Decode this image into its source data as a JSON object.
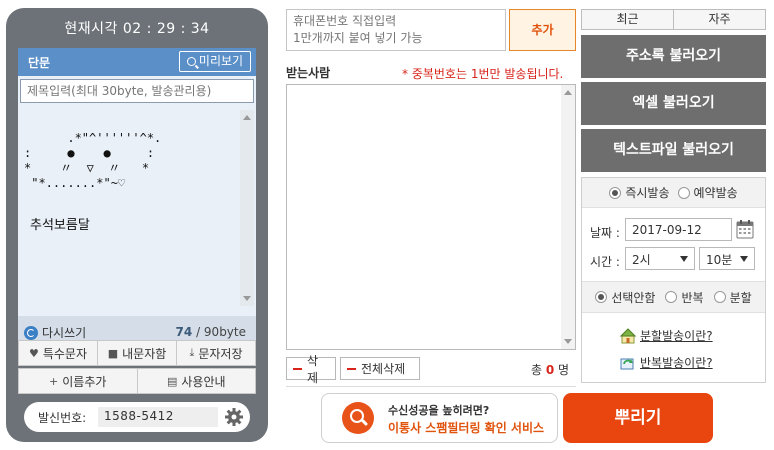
{
  "phone": {
    "clock": "현재시각 02 : 29 : 34",
    "msg_type": "단문",
    "preview_label": "미리보기",
    "title_placeholder": "제목입력(최대 30byte, 발송관리용)",
    "message_art": ".*\"^''''''^*.\n:     ●    ●     :\n*    〃  ▽  〃   *\n \"*.......*\"~♡",
    "message_signature": "추석보름달",
    "rewrite_label": "다시쓰기",
    "byte_used": "74",
    "byte_max": " / 90byte",
    "tools_row1": [
      "특수문자",
      "내문자함",
      "문자저장"
    ],
    "tools_row2": [
      "이름추가",
      "사용안내"
    ],
    "sender_label": "발신번호:",
    "sender_number": "1588-5412"
  },
  "middle": {
    "phone_input_placeholder": "휴대폰번호 직접입력\n1만개까지 붙여 넣기 가능",
    "add_label": "추가",
    "receivers_label": "받는사람",
    "dup_note": "* 중복번호는 1번만 발송됩니다.",
    "delete_label": "삭제",
    "delete_all_label": "전체삭제",
    "total_prefix": "총 ",
    "total_count": "0",
    "total_suffix": " 명",
    "spam_line1": "수신성공을 높히려면?",
    "spam_line2": "이통사 스팸필터링 확인 서비스",
    "send_label": "뿌리기"
  },
  "right": {
    "tabs": [
      "최근",
      "자주"
    ],
    "load_buttons": [
      "주소록 불러오기",
      "엑셀 불러오기",
      "텍스트파일 불러오기"
    ],
    "send_mode": [
      "즉시발송",
      "예약발송"
    ],
    "date_label": "날짜 :",
    "date_value": "2017-09-12",
    "time_label": "시간 :",
    "hour_value": "2시",
    "minute_value": "10분",
    "repeat_options": [
      "선택안함",
      "반복",
      "분할"
    ],
    "split_help": "분할발송이란?",
    "repeat_help": "반복발송이란?"
  }
}
